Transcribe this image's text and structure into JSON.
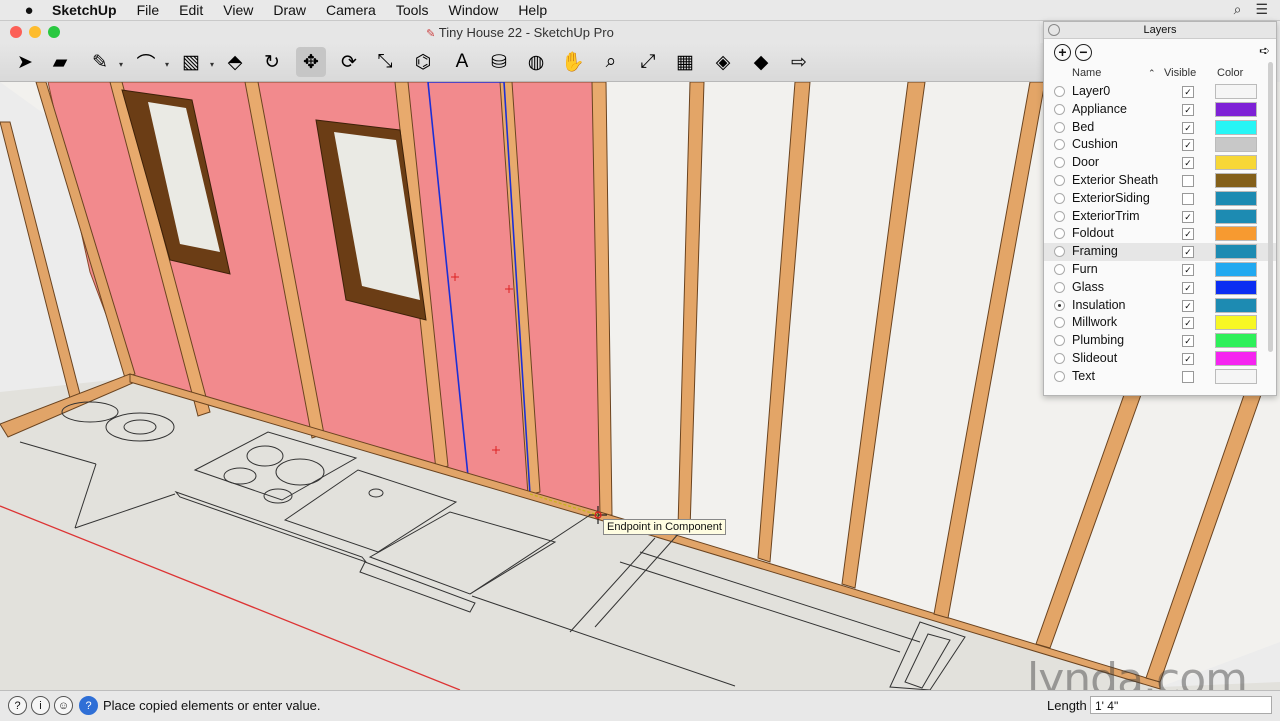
{
  "menubar": {
    "app": "SketchUp",
    "items": [
      "File",
      "Edit",
      "View",
      "Draw",
      "Camera",
      "Tools",
      "Window",
      "Help"
    ]
  },
  "window": {
    "title": "Tiny House 22 - SketchUp Pro"
  },
  "toolbar": {
    "tools": [
      {
        "icon": "select-arrow-icon",
        "glyph": "➤"
      },
      {
        "icon": "eraser-icon",
        "glyph": "▰"
      },
      {
        "icon": "pencil-line-icon",
        "glyph": "✎"
      },
      {
        "icon": "arc-icon",
        "glyph": "⌒"
      },
      {
        "icon": "rectangle-icon",
        "glyph": "▧"
      },
      {
        "icon": "push-pull-icon",
        "glyph": "⬘"
      },
      {
        "icon": "offset-icon",
        "glyph": "↻"
      },
      {
        "icon": "move-icon",
        "glyph": "✥"
      },
      {
        "icon": "rotate-icon",
        "glyph": "⟳"
      },
      {
        "icon": "scale-icon",
        "glyph": "⤡"
      },
      {
        "icon": "tape-measure-icon",
        "glyph": "⌬"
      },
      {
        "icon": "text-icon",
        "glyph": "A"
      },
      {
        "icon": "paint-bucket-icon",
        "glyph": "⛁"
      },
      {
        "icon": "orbit-icon",
        "glyph": "◍"
      },
      {
        "icon": "pan-icon",
        "glyph": "✋"
      },
      {
        "icon": "zoom-icon",
        "glyph": "⌕"
      },
      {
        "icon": "zoom-extents-icon",
        "glyph": "⤢"
      },
      {
        "icon": "3d-warehouse-icon",
        "glyph": "▦"
      },
      {
        "icon": "extension-warehouse-icon",
        "glyph": "◈"
      },
      {
        "icon": "ruby-icon",
        "glyph": "◆"
      },
      {
        "icon": "send-to-layout-icon",
        "glyph": "⇨"
      }
    ]
  },
  "viewport": {
    "tooltip": "Endpoint in Component"
  },
  "watermark": "lynda.com",
  "status": {
    "message": "Place copied elements or enter value.",
    "measure_label": "Length",
    "measure_value": "1' 4\""
  },
  "layers_panel": {
    "title": "Layers",
    "columns": {
      "name": "Name",
      "visible": "Visible",
      "color": "Color"
    },
    "rows": [
      {
        "name": "Layer0",
        "visible": true,
        "color": "#f5f5f5",
        "active": false
      },
      {
        "name": "Appliance",
        "visible": true,
        "color": "#7e22d6",
        "active": false
      },
      {
        "name": "Bed",
        "visible": true,
        "color": "#27f5f5",
        "active": false
      },
      {
        "name": "Cushion",
        "visible": true,
        "color": "#c8c8c8",
        "active": false
      },
      {
        "name": "Door",
        "visible": true,
        "color": "#f7d736",
        "active": false
      },
      {
        "name": "Exterior Sheath",
        "visible": false,
        "color": "#84601a",
        "active": false
      },
      {
        "name": "ExteriorSiding",
        "visible": false,
        "color": "#1d8bb2",
        "active": false
      },
      {
        "name": "ExteriorTrim",
        "visible": true,
        "color": "#1d8bb2",
        "active": false
      },
      {
        "name": "Foldout",
        "visible": true,
        "color": "#f79a30",
        "active": false
      },
      {
        "name": "Framing",
        "visible": true,
        "color": "#1d8bb2",
        "active": false
      },
      {
        "name": "Furn",
        "visible": true,
        "color": "#22a9f0",
        "active": false
      },
      {
        "name": "Glass",
        "visible": true,
        "color": "#0b2ef2",
        "active": false
      },
      {
        "name": "Insulation",
        "visible": true,
        "color": "#1d8bb2",
        "active": true
      },
      {
        "name": "Millwork",
        "visible": true,
        "color": "#f7f724",
        "active": false
      },
      {
        "name": "Plumbing",
        "visible": true,
        "color": "#2ef05a",
        "active": false
      },
      {
        "name": "Slideout",
        "visible": true,
        "color": "#f524f0",
        "active": false
      },
      {
        "name": "Text",
        "visible": false,
        "color": "#f5f5f5",
        "active": false
      }
    ]
  }
}
